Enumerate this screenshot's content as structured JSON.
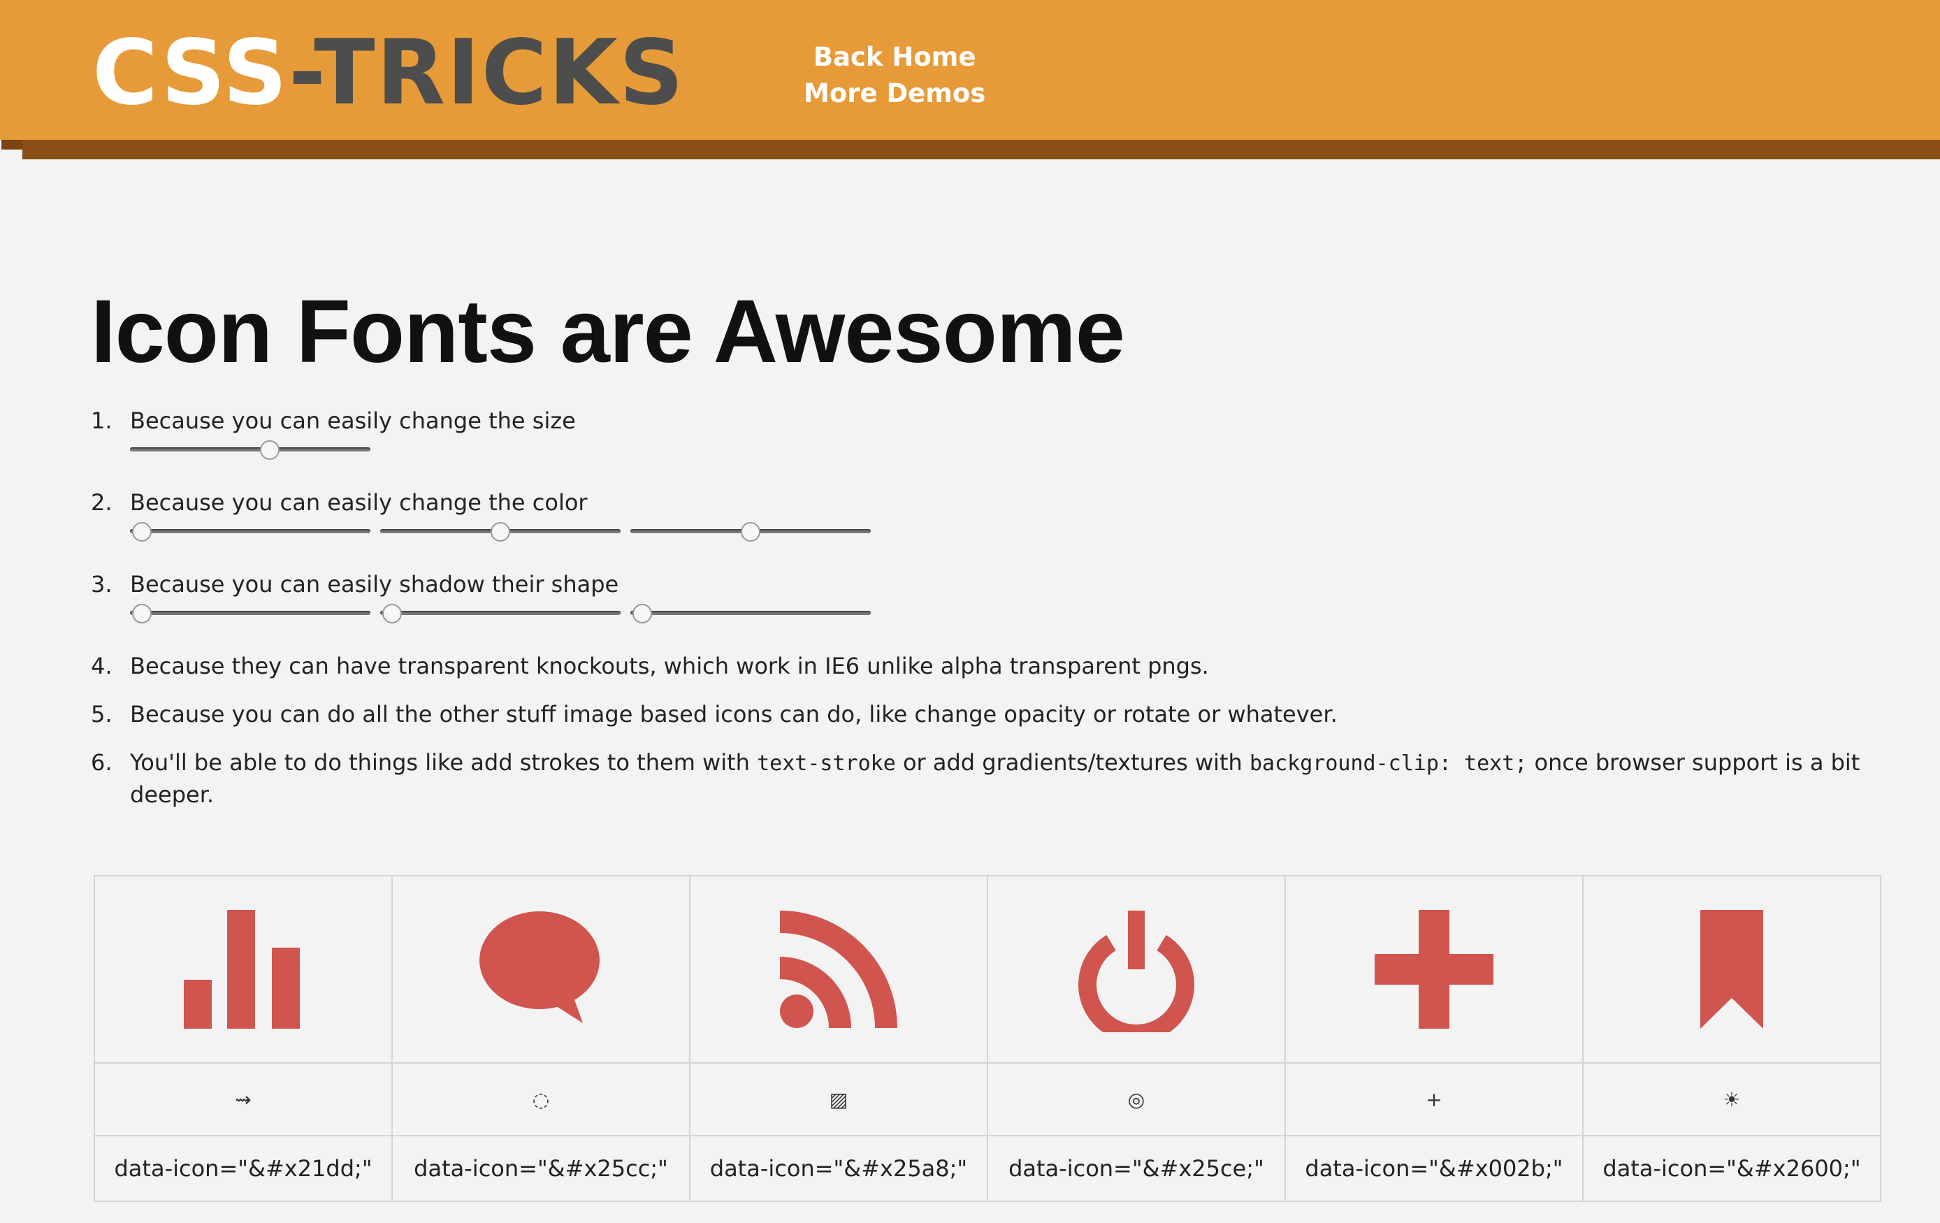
{
  "header": {
    "logo": {
      "part1": "CSS",
      "part2": "-TRICKS"
    },
    "nav": [
      "Back Home",
      "More Demos"
    ]
  },
  "main": {
    "title": "Icon Fonts are Awesome",
    "list": [
      {
        "num": "1.",
        "text": "Because you can easily change the size",
        "sliders": [
          0.58
        ]
      },
      {
        "num": "2.",
        "text": "Because you can easily change the color",
        "sliders": [
          0.05,
          0.5,
          0.5
        ]
      },
      {
        "num": "3.",
        "text": "Because you can easily shadow their shape",
        "sliders": [
          0.05,
          0.05,
          0.05
        ]
      },
      {
        "num": "4.",
        "text": "Because they can have transparent knockouts, which work in IE6 unlike alpha transparent pngs."
      },
      {
        "num": "5.",
        "text": "Because you can do all the other stuff image based icons can do, like change opacity or rotate or whatever."
      },
      {
        "num": "6.",
        "text_a": "You'll be able to do things like add strokes to them with ",
        "code_a": "text-stroke",
        "text_b": " or add gradients/textures with ",
        "code_b": "background-clip: text;",
        "text_c": " once browser support is a bit deeper."
      }
    ]
  },
  "icons": {
    "color": "#d0554f",
    "items": [
      {
        "icon": "bar-chart-icon",
        "glyph": "⇝",
        "label": "data-icon=\"&#x21dd;\""
      },
      {
        "icon": "speech-bubble-icon",
        "glyph": "◌",
        "label": "data-icon=\"&#x25cc;\""
      },
      {
        "icon": "rss-icon",
        "glyph": "▨",
        "label": "data-icon=\"&#x25a8;\""
      },
      {
        "icon": "power-icon",
        "glyph": "◎",
        "label": "data-icon=\"&#x25ce;\""
      },
      {
        "icon": "plus-icon",
        "glyph": "+",
        "label": "data-icon=\"&#x002b;\""
      },
      {
        "icon": "bookmark-icon",
        "glyph": "☀",
        "label": "data-icon=\"&#x2600;\""
      }
    ]
  }
}
